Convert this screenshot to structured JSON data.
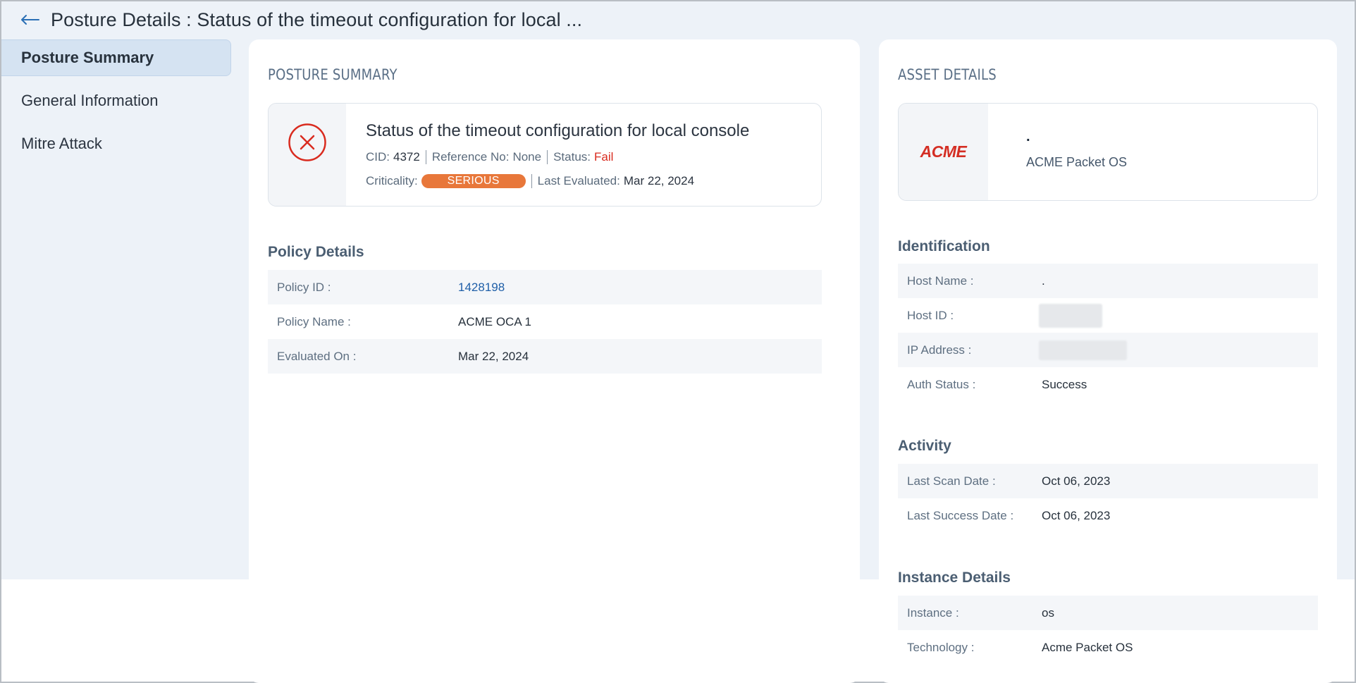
{
  "header": {
    "title": "Posture Details : Status of the timeout configuration for local ..."
  },
  "sidebar": {
    "items": [
      {
        "label": "Posture Summary",
        "active": true
      },
      {
        "label": "General Information",
        "active": false
      },
      {
        "label": "Mitre Attack",
        "active": false
      }
    ]
  },
  "posture_summary": {
    "card_title": "POSTURE SUMMARY",
    "status_icon": "x-circle-icon",
    "control_title": "Status of the timeout configuration for local console",
    "cid_label": "CID:",
    "cid_value": "4372",
    "reference_label": "Reference No:",
    "reference_value": "None",
    "status_label": "Status:",
    "status_value": "Fail",
    "criticality_label": "Criticality:",
    "criticality_value": "SERIOUS",
    "last_evaluated_label": "Last Evaluated:",
    "last_evaluated_value": "Mar 22, 2024",
    "colors": {
      "fail": "#d92b1f",
      "serious_badge": "#e8773a"
    }
  },
  "policy_details": {
    "section_title": "Policy Details",
    "rows": [
      {
        "label": "Policy ID :",
        "value": "1428198"
      },
      {
        "label": "Policy Name :",
        "value": "ACME OCA 1"
      },
      {
        "label": "Evaluated On :",
        "value": "Mar 22, 2024"
      }
    ]
  },
  "asset_details": {
    "card_title": "ASSET DETAILS",
    "logo_text": "ACME",
    "host_name": ".",
    "os_name": "ACME Packet OS",
    "identification": {
      "section_title": "Identification",
      "rows": [
        {
          "label": "Host Name :",
          "value": "."
        },
        {
          "label": "Host ID :",
          "value": ""
        },
        {
          "label": "IP Address :",
          "value": ""
        },
        {
          "label": "Auth Status :",
          "value": "Success"
        }
      ]
    },
    "activity": {
      "section_title": "Activity",
      "rows": [
        {
          "label": "Last Scan Date :",
          "value": "Oct 06, 2023"
        },
        {
          "label": "Last Success Date :",
          "value": "Oct 06, 2023"
        }
      ]
    },
    "instance": {
      "section_title": "Instance Details",
      "rows": [
        {
          "label": "Instance :",
          "value": "os"
        },
        {
          "label": "Technology :",
          "value": "Acme Packet OS"
        }
      ]
    }
  }
}
